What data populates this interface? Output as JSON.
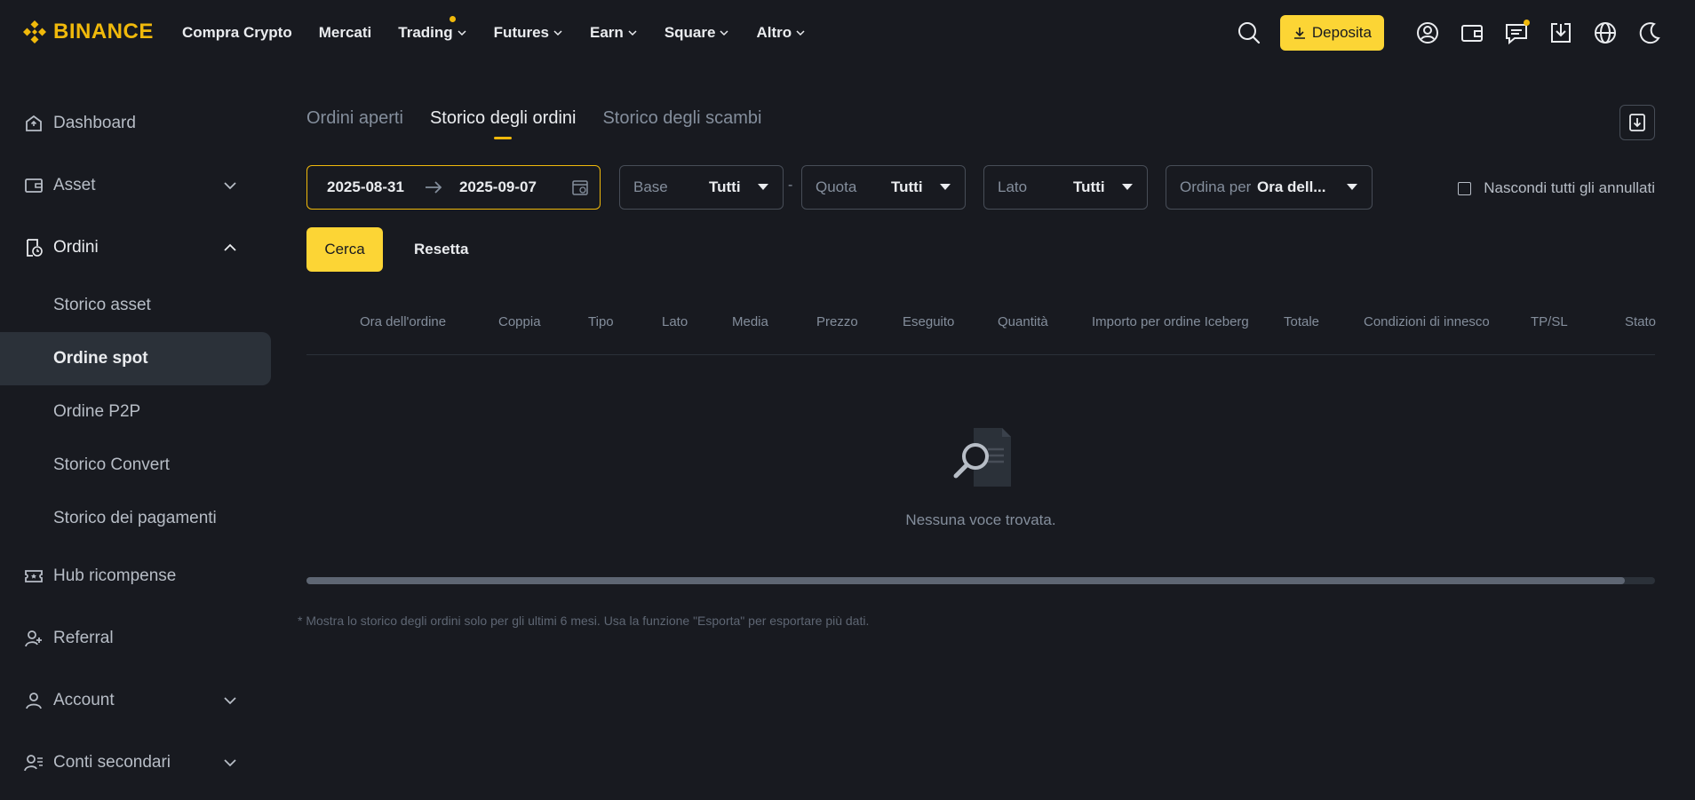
{
  "brand": {
    "name": "BINANCE",
    "color": "#f0b90b"
  },
  "nav": {
    "items": [
      {
        "label": "Compra Crypto",
        "has_menu": false
      },
      {
        "label": "Mercati",
        "has_menu": false
      },
      {
        "label": "Trading",
        "has_menu": true,
        "dot": true
      },
      {
        "label": "Futures",
        "has_menu": true
      },
      {
        "label": "Earn",
        "has_menu": true
      },
      {
        "label": "Square",
        "has_menu": true
      },
      {
        "label": "Altro",
        "has_menu": true
      }
    ],
    "deposit_label": "Deposita",
    "icons": [
      "search-icon",
      "download-icon",
      "user-icon",
      "wallet-icon",
      "message-icon",
      "app-download-icon",
      "globe-icon",
      "moon-icon"
    ]
  },
  "sidebar": {
    "items": [
      {
        "label": "Dashboard",
        "icon": "home-icon"
      },
      {
        "label": "Asset",
        "icon": "wallet-icon",
        "expandable": true
      },
      {
        "label": "Ordini",
        "icon": "orders-icon",
        "expandable": true,
        "open": true
      },
      {
        "label": "Hub ricompense",
        "icon": "ticket-icon"
      },
      {
        "label": "Referral",
        "icon": "add-user-icon"
      },
      {
        "label": "Account",
        "icon": "person-icon",
        "expandable": true
      },
      {
        "label": "Conti secondari",
        "icon": "sub-accounts-icon",
        "expandable": true
      }
    ],
    "orders_sub": [
      {
        "label": "Storico asset"
      },
      {
        "label": "Ordine spot",
        "active": true
      },
      {
        "label": "Ordine P2P"
      },
      {
        "label": "Storico Convert"
      },
      {
        "label": "Storico dei pagamenti"
      }
    ]
  },
  "main": {
    "tabs": [
      {
        "label": "Ordini aperti"
      },
      {
        "label": "Storico degli ordini",
        "active": true
      },
      {
        "label": "Storico degli scambi"
      }
    ],
    "filters": {
      "date_from": "2025-08-31",
      "date_to": "2025-09-07",
      "base_placeholder": "Base",
      "base_value": "Tutti",
      "quote_placeholder": "Quota",
      "quote_value": "Tutti",
      "side_placeholder": "Lato",
      "side_value": "Tutti",
      "sort_placeholder": "Ordina per",
      "sort_value": "Ora dell...",
      "hide_cancelled_label": "Nascondi tutti gli annullati",
      "hide_cancelled_checked": false
    },
    "search_label": "Cerca",
    "reset_label": "Resetta",
    "table": {
      "columns": [
        "Ora dell'ordine",
        "Coppia",
        "Tipo",
        "Lato",
        "Media",
        "Prezzo",
        "Eseguito",
        "Quantità",
        "Importo per ordine Iceberg",
        "Totale",
        "Condizioni di innesco",
        "TP/SL",
        "Stato"
      ],
      "rows": [],
      "empty_text": "Nessuna voce trovata."
    },
    "footnote": "* Mostra lo storico degli ordini solo per gli ultimi 6 mesi. Usa la funzione \"Esporta\" per esportare più dati."
  },
  "colors": {
    "background": "#181a20",
    "accent": "#fcd535",
    "border": "#474d57",
    "muted_text": "#848e9c"
  }
}
